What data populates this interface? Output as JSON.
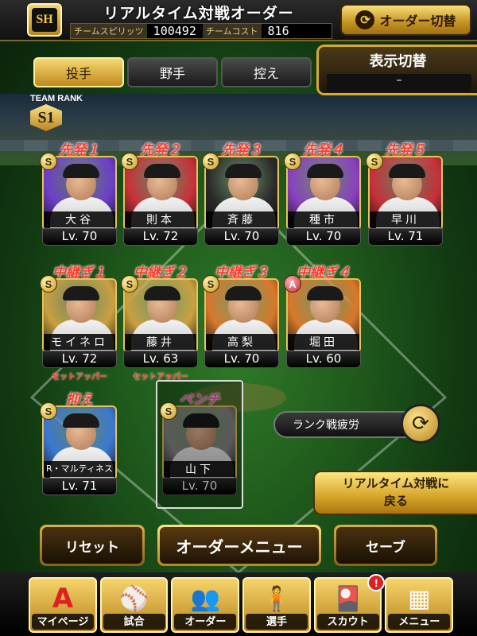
{
  "header": {
    "team_logo_text": "SH",
    "title": "リアルタイム対戦オーダー",
    "spirits_label": "チームスピリッツ",
    "spirits_value": "100492",
    "cost_label": "チームコスト",
    "cost_value": "816",
    "order_switch_label": "オーダー切替"
  },
  "tabs": [
    {
      "label": "投手",
      "active": true
    },
    {
      "label": "野手",
      "active": false
    },
    {
      "label": "控え",
      "active": false
    }
  ],
  "display_toggle": {
    "label": "表示切替",
    "value": "–"
  },
  "team_rank": {
    "label": "TEAM RANK",
    "value": "S1"
  },
  "starters": [
    {
      "role": "先発１",
      "grade": "S",
      "name": "大谷",
      "level": "Lv. 70",
      "theme": "purple"
    },
    {
      "role": "先発２",
      "grade": "S",
      "name": "則本",
      "level": "Lv. 72",
      "theme": "red"
    },
    {
      "role": "先発３",
      "grade": "S",
      "name": "斉藤",
      "level": "Lv. 70",
      "theme": "black"
    },
    {
      "role": "先発４",
      "grade": "S",
      "name": "種市",
      "level": "Lv. 70",
      "theme": "violet"
    },
    {
      "role": "先発５",
      "grade": "S",
      "name": "早川",
      "level": "Lv. 71",
      "theme": "red"
    }
  ],
  "relievers": [
    {
      "role": "中継ぎ１",
      "grade": "S",
      "name": "モイネロ",
      "level": "Lv. 72",
      "sub_role": "セットアッパー",
      "theme": "gold"
    },
    {
      "role": "中継ぎ２",
      "grade": "S",
      "name": "藤井",
      "level": "Lv. 63",
      "sub_role": "セットアッパー",
      "theme": "gold"
    },
    {
      "role": "中継ぎ３",
      "grade": "S",
      "name": "高梨",
      "level": "Lv. 70",
      "sub_role": "",
      "theme": "orange"
    },
    {
      "role": "中継ぎ４",
      "grade": "A",
      "name": "堀田",
      "level": "Lv. 60",
      "sub_role": "",
      "theme": "orange"
    }
  ],
  "closer": {
    "role": "抑え",
    "grade": "S",
    "name": "R・マルティネス",
    "level": "Lv. 71",
    "theme": "blue"
  },
  "bench": {
    "role": "ベンチ",
    "grade": "S",
    "name": "山下",
    "level": "Lv. 70",
    "theme": "gray"
  },
  "fatigue": {
    "label": "ランク戦疲労"
  },
  "back_button": {
    "line1": "リアルタイム対戦に",
    "line2": "戻る"
  },
  "actions": {
    "reset": "リセット",
    "order_menu": "オーダーメニュー",
    "save": "セーブ"
  },
  "nav": [
    {
      "label": "マイページ",
      "icon": "mypage-icon",
      "glyph": "A"
    },
    {
      "label": "試合",
      "icon": "stadium-icon",
      "glyph": "⚾"
    },
    {
      "label": "オーダー",
      "icon": "order-icon",
      "glyph": "👥"
    },
    {
      "label": "選手",
      "icon": "player-icon",
      "glyph": "🧍"
    },
    {
      "label": "スカウト",
      "icon": "scout-icon",
      "glyph": "🎴",
      "badge": "!"
    },
    {
      "label": "メニュー",
      "icon": "menu-icon",
      "glyph": "▦"
    }
  ],
  "theme_colors": {
    "purple": "#6b3ec8",
    "red": "#c8303a",
    "black": "#2a2a2a",
    "violet": "#8a40c0",
    "gold": "#c9a040",
    "orange": "#d8782a",
    "blue": "#3a78d0",
    "gray": "#8a8a8a"
  }
}
